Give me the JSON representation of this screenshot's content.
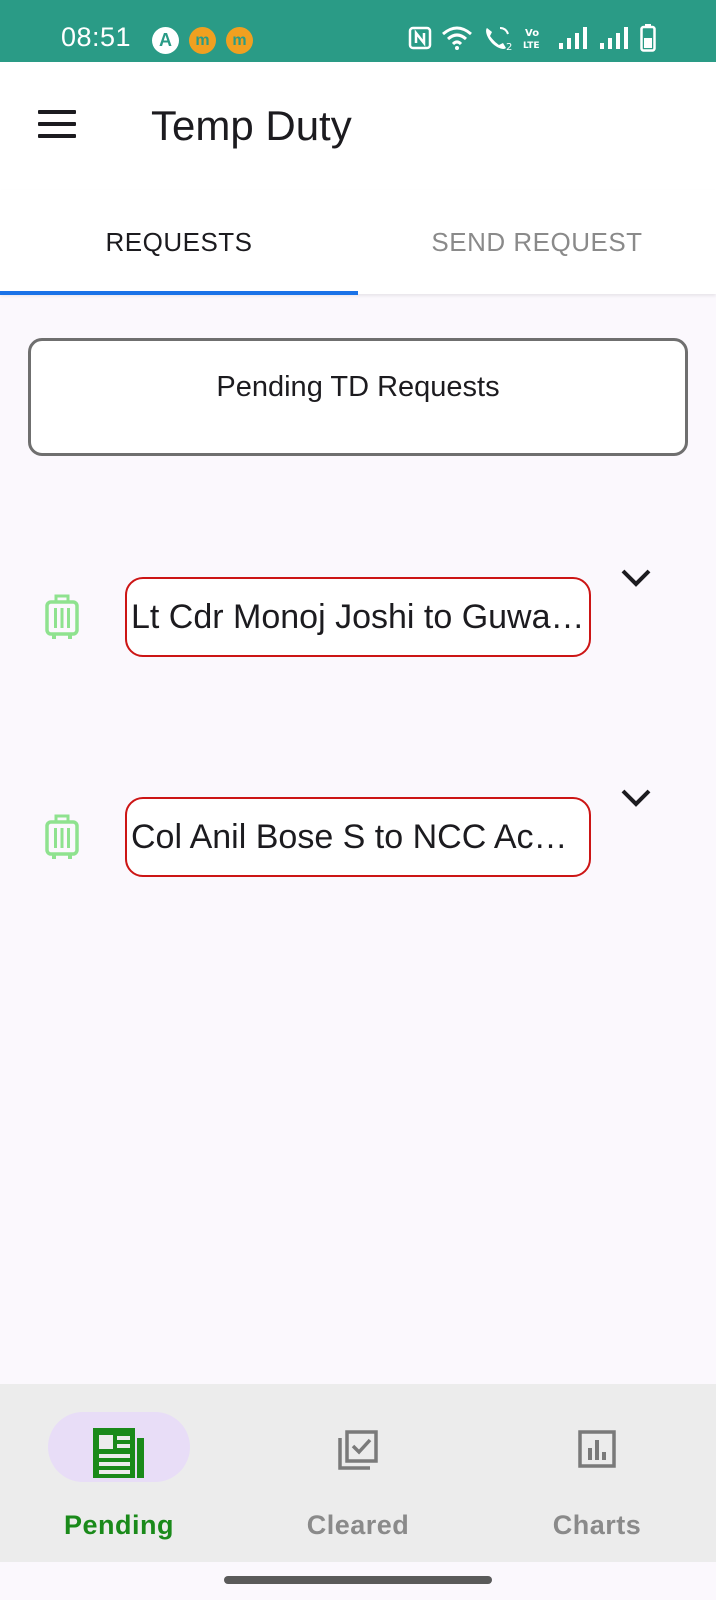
{
  "status_bar": {
    "time": "08:51",
    "notifications": [
      "app-a-icon",
      "m-app-icon",
      "m-app-icon"
    ],
    "a_glyph": "A",
    "m_glyph": "m",
    "system_icons": [
      "nfc-icon",
      "wifi-icon",
      "wifi-calling-icon",
      "volte-icon",
      "signal-icon",
      "signal-icon",
      "battery-icon"
    ],
    "color": "#2a9b86"
  },
  "app_bar": {
    "menu_icon": "menu-icon",
    "title": "Temp Duty"
  },
  "tabs": [
    {
      "label": "REQUESTS",
      "active": true
    },
    {
      "label": "SEND REQUEST",
      "active": false
    }
  ],
  "tab_indicator_color": "#1a73e8",
  "section": {
    "title": "Pending TD Requests"
  },
  "requests": [
    {
      "icon": "luggage-icon",
      "text": "Lt Cdr Monoj Joshi to Guwa…",
      "expand_icon": "chevron-down-icon"
    },
    {
      "icon": "luggage-icon",
      "text": "Col Anil Bose S to NCC Aca…",
      "expand_icon": "chevron-down-icon"
    }
  ],
  "bottom_nav": [
    {
      "label": "Pending",
      "icon": "newspaper-icon",
      "active": true
    },
    {
      "label": "Cleared",
      "icon": "checklist-icon",
      "active": false
    },
    {
      "label": "Charts",
      "icon": "bar-chart-icon",
      "active": false
    }
  ],
  "colors": {
    "accent_green": "#1a8a1a",
    "chip_border": "#cc1515",
    "luggage_icon": "#8fe28f",
    "nav_pill": "#e8ddf7"
  }
}
